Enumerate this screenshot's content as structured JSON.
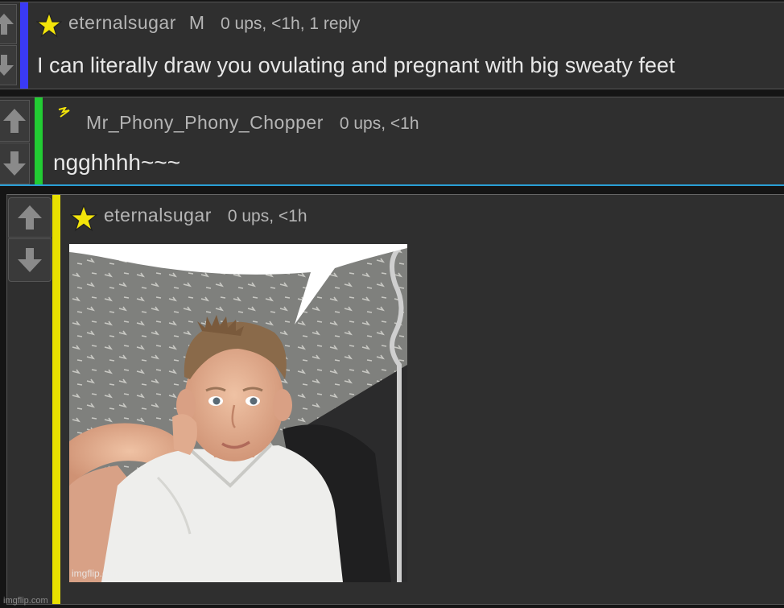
{
  "comments": [
    {
      "username": "eternalsugar",
      "badge": "M",
      "stats": "0 ups, <1h, 1 reply",
      "text": "I can literally draw you ovulating and pregnant with big sweaty feet",
      "rail_color": "#3a3af5",
      "icon": "star-icon"
    },
    {
      "username": "Mr_Phony_Phony_Chopper",
      "stats": "0 ups, <1h",
      "text": "ngghhhh~~~",
      "rail_color": "#22cc33",
      "icon": "lightning-icon"
    },
    {
      "username": "eternalsugar",
      "stats": "0 ups, <1h",
      "rail_color": "#e8e000",
      "icon": "star-icon",
      "image": {
        "description": "photo of a smiling boy with spiked hair in a white polo shirt, speech bubble at top",
        "watermark": "imgflip.com"
      }
    }
  ],
  "site_watermark": "imgflip.com",
  "colors": {
    "background": "#2f2f2f",
    "text": "#e8e8e8",
    "meta": "#b5b5b5",
    "reply_line": "#2a9fd6"
  }
}
